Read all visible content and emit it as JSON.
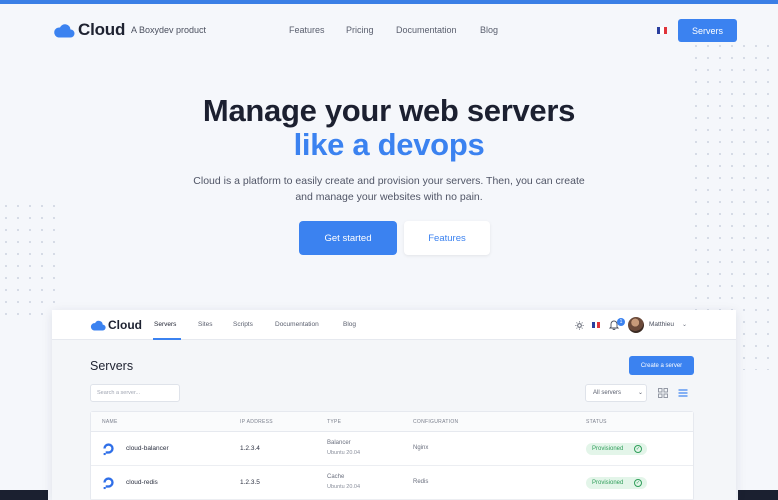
{
  "site": {
    "logo_text": "Cloud",
    "tagline": "A Boxydev product",
    "nav": [
      "Features",
      "Pricing",
      "Documentation",
      "Blog"
    ],
    "servers_button": "Servers"
  },
  "hero": {
    "title_line1": "Manage your web servers",
    "title_line2": "like a devops",
    "subtitle_line1": "Cloud is a platform to easily create and provision your servers. Then, you can create",
    "subtitle_line2": "and manage your websites with no pain.",
    "cta_primary": "Get started",
    "cta_secondary": "Features"
  },
  "app": {
    "logo_text": "Cloud",
    "tabs": [
      "Servers",
      "Sites",
      "Scripts",
      "Documentation",
      "Blog"
    ],
    "active_tab": "Servers",
    "notifications_count": "1",
    "user_name": "Matthieu",
    "page_title": "Servers",
    "create_button": "Create a server",
    "search_placeholder": "Search a server...",
    "filter_value": "All servers",
    "table": {
      "headers": [
        "NAME",
        "IP ADDRESS",
        "TYPE",
        "CONFIGURATION",
        "STATUS"
      ],
      "rows": [
        {
          "name": "cloud-balancer",
          "ip": "1.2.3.4",
          "type": "Balancer",
          "os": "Ubuntu 20.04",
          "config": "Nginx",
          "status": "Provisioned"
        },
        {
          "name": "cloud-redis",
          "ip": "1.2.3.5",
          "type": "Cache",
          "os": "Ubuntu 20.04",
          "config": "Redis",
          "status": "Provisioned"
        }
      ]
    }
  },
  "colors": {
    "primary": "#3b82f0",
    "success": "#2f9e5a"
  },
  "icons": [
    "cloud-logo-icon",
    "france-flag-icon",
    "sun-icon",
    "bell-icon",
    "chevron-down-icon",
    "grid-view-icon",
    "list-view-icon",
    "digitalocean-icon",
    "check-circle-icon"
  ]
}
